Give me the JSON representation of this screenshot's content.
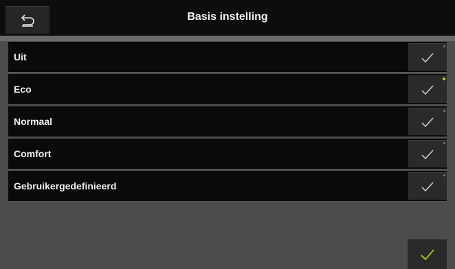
{
  "header": {
    "title": "Basis instelling",
    "back_icon": "back-arrow-icon"
  },
  "options": [
    {
      "label": "Uit",
      "selected": false
    },
    {
      "label": "Eco",
      "selected": true
    },
    {
      "label": "Normaal",
      "selected": false
    },
    {
      "label": "Comfort",
      "selected": false
    },
    {
      "label": "Gebruikergedefinieerd",
      "selected": false
    }
  ],
  "colors": {
    "accent": "#b8e000",
    "row_background": "#0a0a0a",
    "page_background": "#4c4c4c"
  },
  "confirm": {
    "icon": "check-icon"
  }
}
